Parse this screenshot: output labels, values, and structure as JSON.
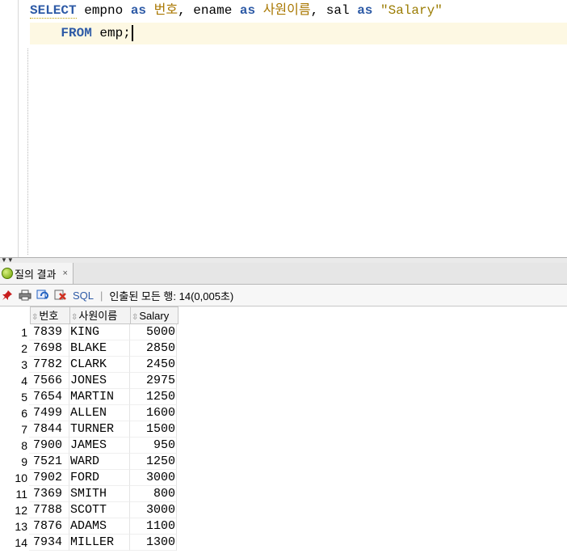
{
  "editor": {
    "line1": {
      "kw_select": "SELECT",
      "col1": " empno ",
      "as1": "as",
      "alias1": " 번호",
      "comma1": ", ename ",
      "as2": "as",
      "alias2": " 사원이름",
      "comma2": ", sal ",
      "as3": "as",
      "alias3": " \"Salary\""
    },
    "line2": {
      "indent": "    ",
      "kw_from": "FROM",
      "table": " emp;"
    }
  },
  "results": {
    "tab_label": "질의 결과",
    "tab_close": "×",
    "toolbar": {
      "sql_label": "SQL",
      "separator": "|",
      "status": "인출된 모든 행: 14(0,005초)"
    },
    "columns": [
      "번호",
      "사원이름",
      "Salary"
    ],
    "rows": [
      {
        "n": "1",
        "no": "7839",
        "name": "KING",
        "sal": "5000"
      },
      {
        "n": "2",
        "no": "7698",
        "name": "BLAKE",
        "sal": "2850"
      },
      {
        "n": "3",
        "no": "7782",
        "name": "CLARK",
        "sal": "2450"
      },
      {
        "n": "4",
        "no": "7566",
        "name": "JONES",
        "sal": "2975"
      },
      {
        "n": "5",
        "no": "7654",
        "name": "MARTIN",
        "sal": "1250"
      },
      {
        "n": "6",
        "no": "7499",
        "name": "ALLEN",
        "sal": "1600"
      },
      {
        "n": "7",
        "no": "7844",
        "name": "TURNER",
        "sal": "1500"
      },
      {
        "n": "8",
        "no": "7900",
        "name": "JAMES",
        "sal": "950"
      },
      {
        "n": "9",
        "no": "7521",
        "name": "WARD",
        "sal": "1250"
      },
      {
        "n": "10",
        "no": "7902",
        "name": "FORD",
        "sal": "3000"
      },
      {
        "n": "11",
        "no": "7369",
        "name": "SMITH",
        "sal": "800"
      },
      {
        "n": "12",
        "no": "7788",
        "name": "SCOTT",
        "sal": "3000"
      },
      {
        "n": "13",
        "no": "7876",
        "name": "ADAMS",
        "sal": "1100"
      },
      {
        "n": "14",
        "no": "7934",
        "name": "MILLER",
        "sal": "1300"
      }
    ]
  },
  "icons": {
    "pin": "pin-icon",
    "print": "print-icon",
    "refresh": "refresh-icon",
    "export": "export-icon",
    "sort": "sort-icon",
    "tab": "query-result-icon"
  },
  "colors": {
    "keyword": "#2d5aa6",
    "korean_alias": "#a97700",
    "current_line": "#fdf8e3"
  }
}
